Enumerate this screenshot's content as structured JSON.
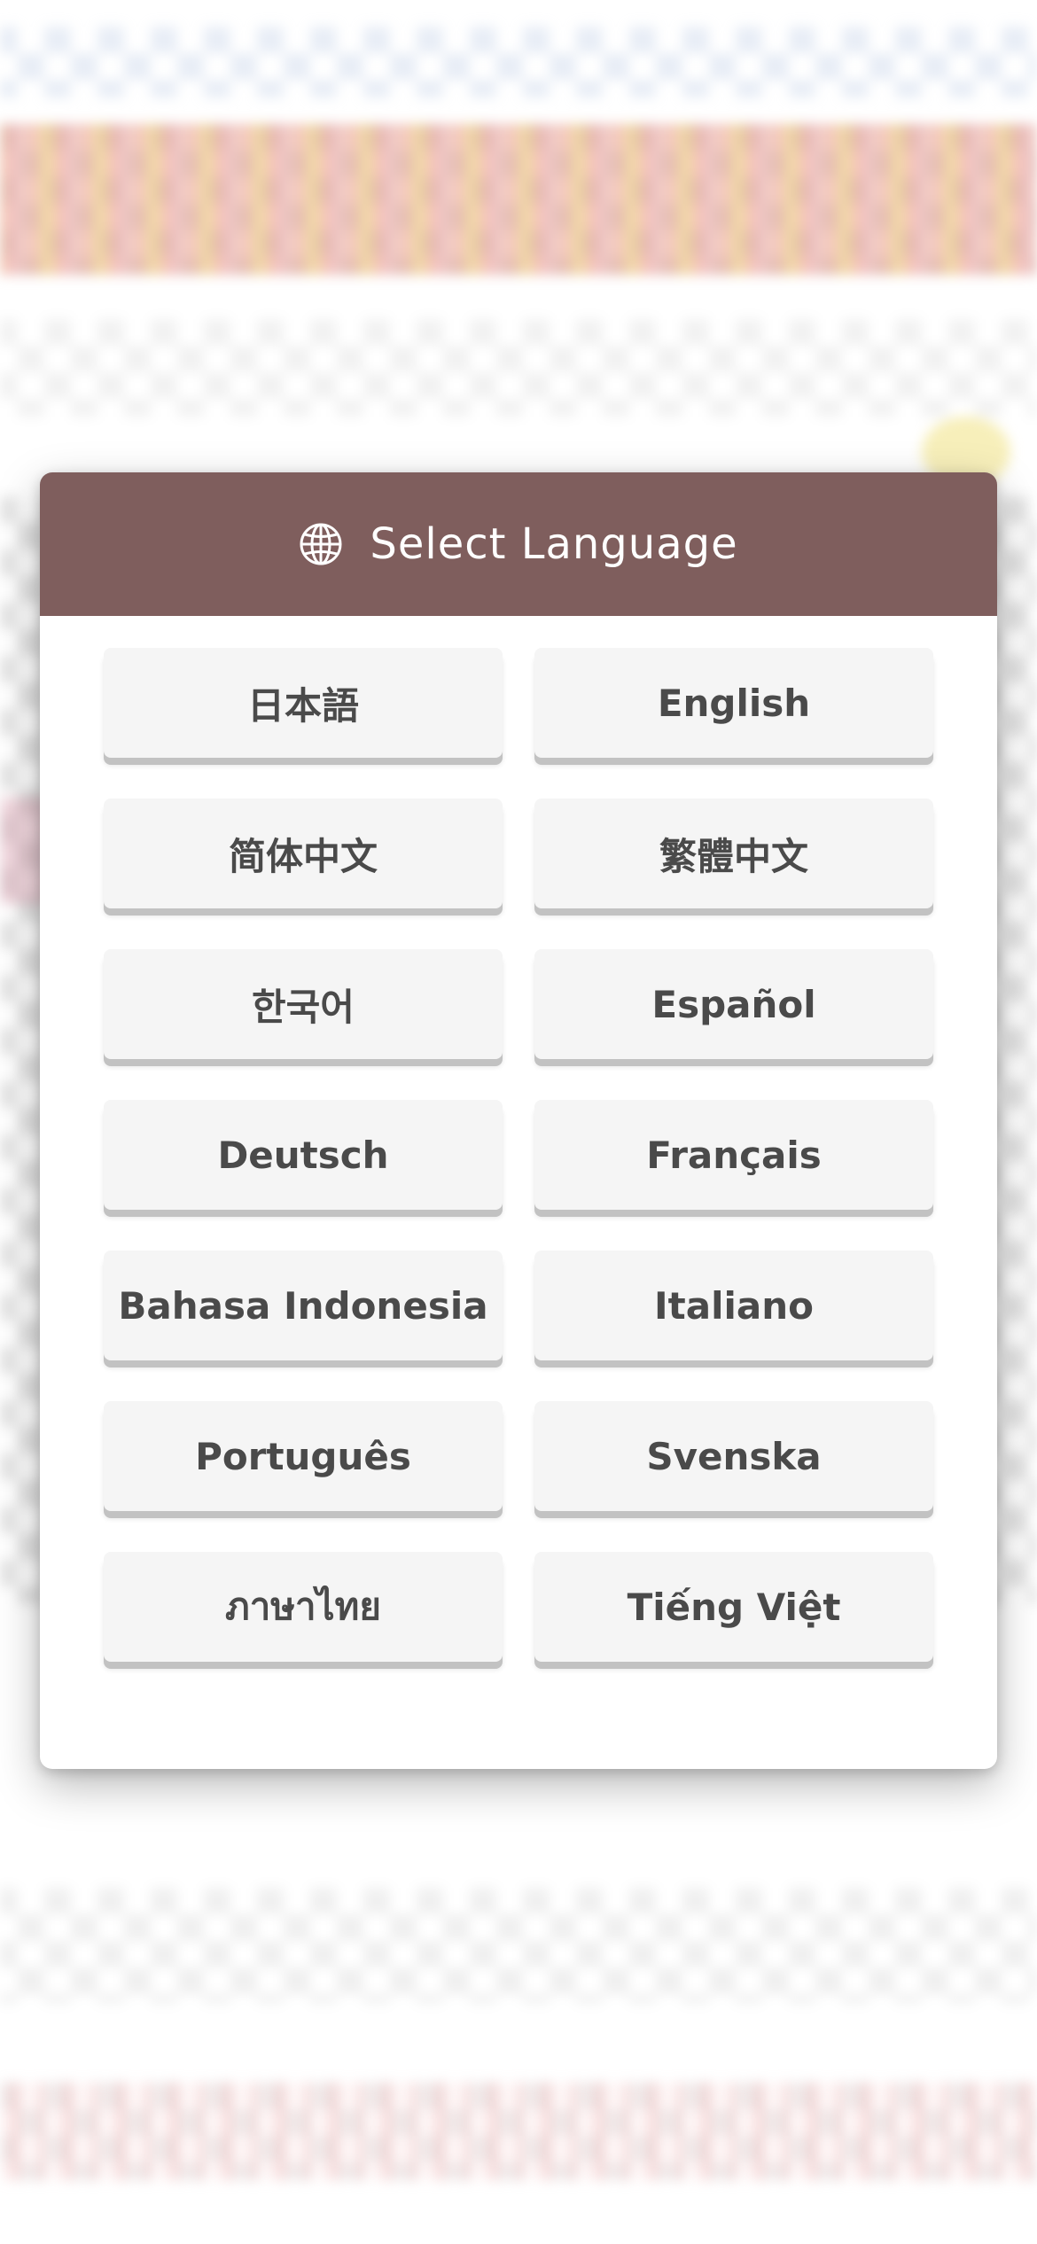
{
  "dialog": {
    "title": "Select Language",
    "header_color": "#7f5e5d",
    "icon": "globe-icon"
  },
  "languages": [
    "日本語",
    "English",
    "简体中文",
    "繁體中文",
    "한국어",
    "Español",
    "Deutsch",
    "Français",
    "Bahasa Indonesia",
    "Italiano",
    "Português",
    "Svenska",
    "ภาษาไทย",
    "Tiếng Việt"
  ]
}
